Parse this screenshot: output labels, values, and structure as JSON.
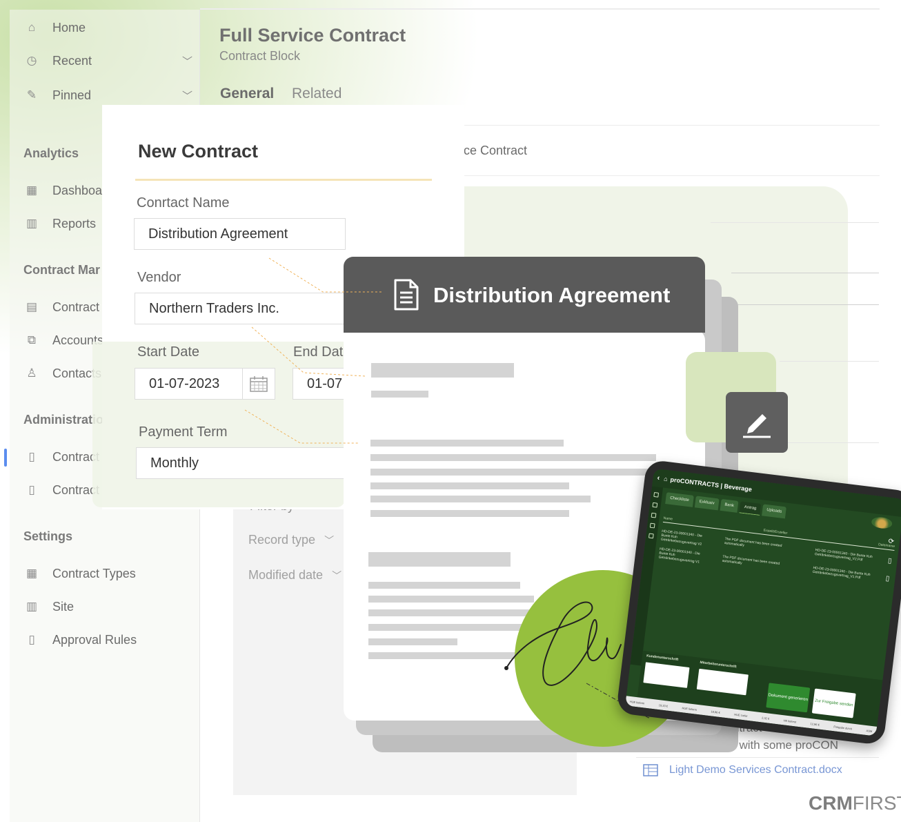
{
  "nav": {
    "items": [
      {
        "icon": "home-icon",
        "label": "Home"
      },
      {
        "icon": "clock-icon",
        "label": "Recent"
      },
      {
        "icon": "pin-icon",
        "label": "Pinned"
      }
    ],
    "sections": [
      {
        "title": "Analytics",
        "items": [
          {
            "icon": "dashboard-icon",
            "label": "Dashboa"
          },
          {
            "icon": "reports-icon",
            "label": "Reports"
          }
        ]
      },
      {
        "title": "Contract Mar",
        "items": [
          {
            "icon": "contract-icon",
            "label": "Contract"
          },
          {
            "icon": "accounts-icon",
            "label": "Accounts"
          },
          {
            "icon": "contacts-icon",
            "label": "Contacts"
          }
        ]
      },
      {
        "title": "Administratio",
        "items": [
          {
            "icon": "contract-doc-icon",
            "label": "Contract"
          },
          {
            "icon": "contract-settings-icon",
            "label": "Contract"
          }
        ]
      },
      {
        "title": "Settings",
        "items": [
          {
            "icon": "grid-icon",
            "label": "Contract Types"
          },
          {
            "icon": "site-icon",
            "label": "Site"
          },
          {
            "icon": "approval-icon",
            "label": "Approval Rules"
          }
        ]
      }
    ]
  },
  "record": {
    "title": "Full Service Contract",
    "subtitle": "Contract Block",
    "tabs": [
      "General",
      "Related"
    ],
    "service_label": "ce Contract",
    "filter_label": "Filter by",
    "filters": [
      "Record type",
      "Modified date"
    ],
    "contract_line1": "ntract",
    "contract_line2": "t with some proCON",
    "attachment": "Light Demo Services Contract.docx"
  },
  "form": {
    "title": "New Contract",
    "contract_name_label": "Conrtact Name",
    "contract_name_value": "Distribution Agreement",
    "vendor_label": "Vendor",
    "vendor_value": "Northern Traders Inc.",
    "start_date_label": "Start Date",
    "start_date_value": "01-07-2023",
    "end_date_label": "End Dat",
    "end_date_value": "01-07",
    "payment_term_label": "Payment Term",
    "payment_term_value": "Monthly"
  },
  "document": {
    "title": "Distribution Agreement"
  },
  "tablet": {
    "app_title": "proCONTRACTS | Beverage",
    "tabs": [
      "Checkliste",
      "Exklusiv",
      "Bank",
      "Antrag",
      "Uploads"
    ],
    "active_tab": "Antrag",
    "col_name": "Name",
    "col_created": "Erstellt/Ersteller",
    "col_file": "Dateiname",
    "rows": [
      {
        "name": "HD-DE-23-00001340 - Die Bunte Kuh Getränkebezugsvertrag V2",
        "info": "The PDF document has been created automatically",
        "file": "HD-DE-23-00001340 - Die Bunte Kuh Getränkebezugsvertrag_V2.Pdf"
      },
      {
        "name": "HD-DE-23-00001340 - Die Bunte Kuh Getränkebezugsvertrag V1",
        "info": "The PDF document has been created automatically",
        "file": "HD-DE-23-00001340 - Die Bunte Kuh Getränkebezugsvertrag_V1.Pdf"
      }
    ],
    "sig_customer_label": "Kundenunterschrift",
    "sig_employee_label": "Mitarbeiterunterschrift",
    "btn_generate": "Dokument generieren",
    "btn_release": "Zur Freigabe senden",
    "footer": [
      "HUE lieferm",
      "19,33 €",
      "HUE lieferm",
      "18,96 €",
      "HUE Liefer",
      "2,32 €",
      "HK lieferst",
      "12,96 €",
      "Freigabe durch",
      "ASM"
    ]
  },
  "brand": {
    "bold": "CRM",
    "light": "FIRST"
  },
  "colors": {
    "accent_green": "#96c03e",
    "doc_header": "#5a5a5a",
    "nav_active": "#5b8def",
    "tablet_green": "#234a22"
  }
}
